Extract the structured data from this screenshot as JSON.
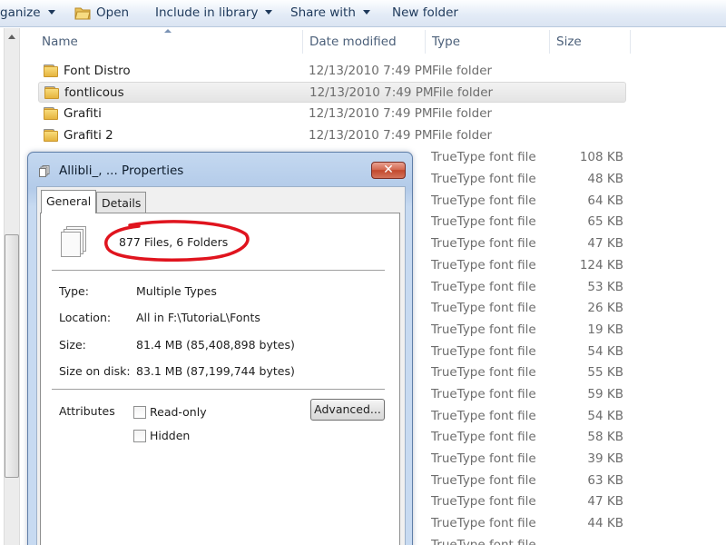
{
  "toolbar": {
    "organize_label": "ganize",
    "open_label": "Open",
    "include_label": "Include in library",
    "share_label": "Share with",
    "new_folder_label": "New folder"
  },
  "columns": {
    "name": "Name",
    "date": "Date modified",
    "type": "Type",
    "size": "Size"
  },
  "folders": [
    {
      "name": "Font Distro",
      "date": "12/13/2010 7:49 PM",
      "type": "File folder"
    },
    {
      "name": "fontlicous",
      "date": "12/13/2010 7:49 PM",
      "type": "File folder"
    },
    {
      "name": "Grafiti",
      "date": "12/13/2010 7:49 PM",
      "type": "File folder"
    },
    {
      "name": "Grafiti 2",
      "date": "12/13/2010 7:49 PM",
      "type": "File folder"
    }
  ],
  "font_files": [
    {
      "type": "TrueType font file",
      "size": "108 KB"
    },
    {
      "type": "TrueType font file",
      "size": "48 KB"
    },
    {
      "type": "TrueType font file",
      "size": "64 KB"
    },
    {
      "type": "TrueType font file",
      "size": "65 KB"
    },
    {
      "type": "TrueType font file",
      "size": "47 KB"
    },
    {
      "type": "TrueType font file",
      "size": "124 KB"
    },
    {
      "type": "TrueType font file",
      "size": "53 KB"
    },
    {
      "type": "TrueType font file",
      "size": "26 KB"
    },
    {
      "type": "TrueType font file",
      "size": "19 KB"
    },
    {
      "type": "TrueType font file",
      "size": "54 KB"
    },
    {
      "type": "TrueType font file",
      "size": "55 KB"
    },
    {
      "type": "TrueType font file",
      "size": "59 KB"
    },
    {
      "type": "TrueType font file",
      "size": "54 KB"
    },
    {
      "type": "TrueType font file",
      "size": "58 KB"
    },
    {
      "type": "TrueType font file",
      "size": "39 KB"
    },
    {
      "type": "TrueType font file",
      "size": "63 KB"
    },
    {
      "type": "TrueType font file",
      "size": "47 KB"
    },
    {
      "type": "TrueType font file",
      "size": "44 KB"
    },
    {
      "type": "TrueType font file",
      "size": ""
    }
  ],
  "dialog": {
    "title": "Allibli_, ... Properties",
    "close_glyph": "✕",
    "tabs": [
      "General",
      "Details"
    ],
    "count_text": "877 Files, 6 Folders",
    "type_label": "Type:",
    "type_value": "Multiple Types",
    "location_label": "Location:",
    "location_value": "All in F:\\TutoriaL\\Fonts",
    "size_label": "Size:",
    "size_value": "81.4 MB (85,408,898 bytes)",
    "disk_label": "Size on disk:",
    "disk_value": "83.1 MB (87,199,744 bytes)",
    "attributes_label": "Attributes",
    "readonly_label": "Read-only",
    "hidden_label": "Hidden",
    "advanced_label": "Advanced..."
  },
  "colors": {
    "annotation_circle": "#e0141e",
    "folder_yellow": "#f0c95a",
    "close_red": "#c7503a"
  }
}
